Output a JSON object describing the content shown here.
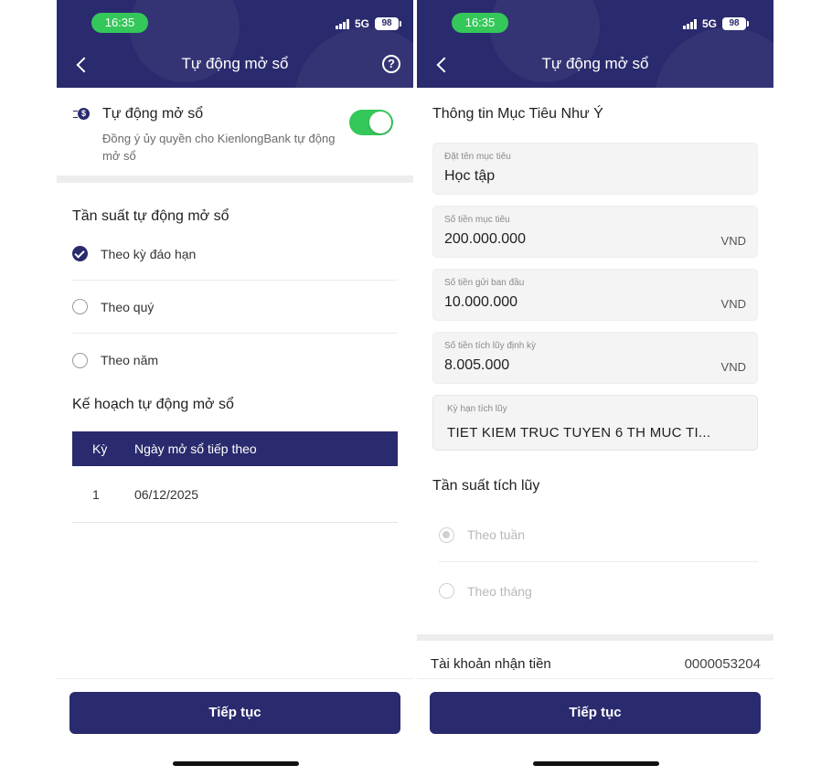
{
  "left_screen": {
    "status": {
      "time": "16:35",
      "network": "5G",
      "battery": "98"
    },
    "header": {
      "title": "Tự động mở sổ"
    },
    "auto_open": {
      "title": "Tự động mở sổ",
      "description": "Đồng ý ủy quyền cho KienlongBank tự động mở sổ",
      "enabled": true
    },
    "frequency": {
      "title": "Tần suất tự động mở sổ",
      "options": [
        {
          "label": "Theo kỳ đáo hạn",
          "selected": true
        },
        {
          "label": "Theo quý",
          "selected": false
        },
        {
          "label": "Theo năm",
          "selected": false
        }
      ]
    },
    "plan": {
      "title": "Kế hoạch tự động mở sổ",
      "columns": [
        "Kỳ",
        "Ngày mở sổ tiếp theo"
      ],
      "rows": [
        [
          "1",
          "06/12/2025"
        ]
      ]
    },
    "continue_label": "Tiếp tục"
  },
  "right_screen": {
    "status": {
      "time": "16:35",
      "network": "5G",
      "battery": "98"
    },
    "header": {
      "title": "Tự động mở sổ"
    },
    "info_title": "Thông tin Mục Tiêu Như Ý",
    "fields": [
      {
        "label": "Đặt tên mục tiêu",
        "value": "Học tập",
        "unit": ""
      },
      {
        "label": "Số tiền mục tiêu",
        "value": "200.000.000",
        "unit": "VND"
      },
      {
        "label": "Số tiền gửi ban đầu",
        "value": "10.000.000",
        "unit": "VND"
      },
      {
        "label": "Số tiền tích lũy định kỳ",
        "value": "8.005.000",
        "unit": "VND"
      },
      {
        "label": "Kỳ hạn tích lũy",
        "value": "TIET KIEM TRUC TUYEN 6 TH MUC TI...",
        "unit": ""
      }
    ],
    "accumulation": {
      "title": "Tần suất tích lũy",
      "options": [
        {
          "label": "Theo tuần",
          "selected": true
        },
        {
          "label": "Theo tháng",
          "selected": false
        }
      ]
    },
    "account": {
      "label": "Tài khoản nhận tiền",
      "number": "0000053204"
    },
    "continue_label": "Tiếp tục"
  },
  "colors": {
    "primary": "#2a2a6e",
    "toggle_on": "#34c759",
    "status_pill": "#34c759"
  }
}
